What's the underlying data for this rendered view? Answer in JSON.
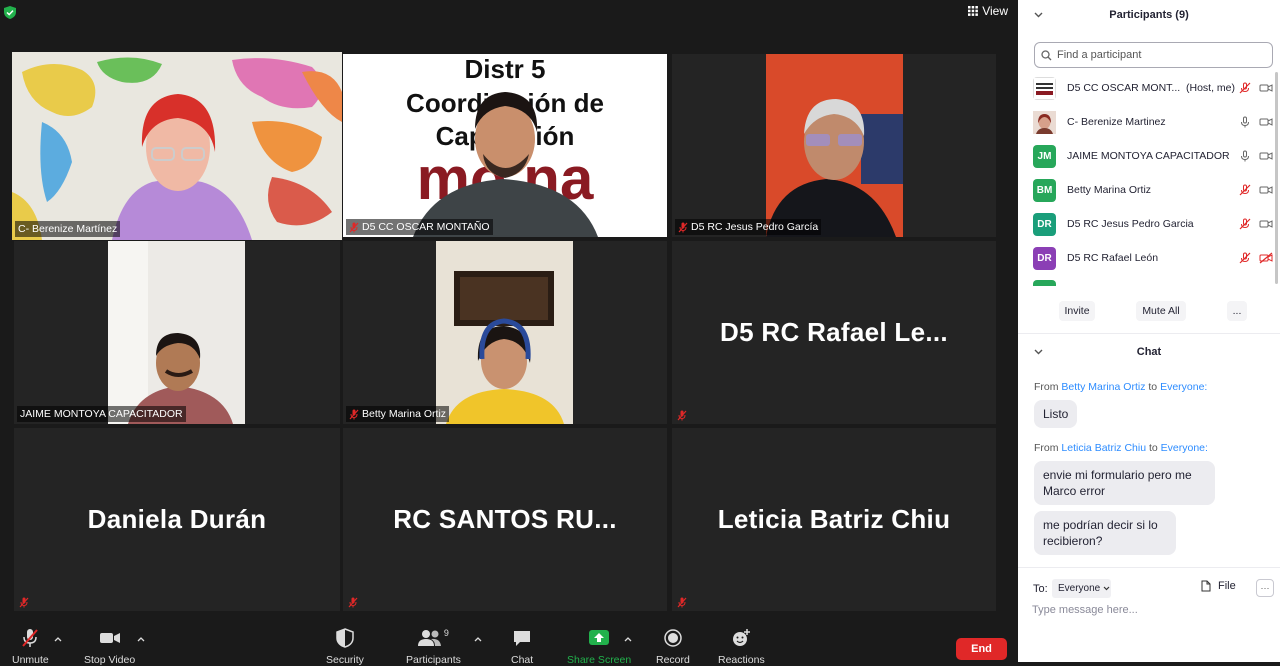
{
  "view_label": "View",
  "tiles": [
    {
      "name": "C- Berenize Martínez",
      "muted": false,
      "active": true
    },
    {
      "name": "D5 CC OSCAR MONTAÑO",
      "muted": true
    },
    {
      "name": "D5 RC Jesus Pedro García",
      "muted": true
    },
    {
      "name": "JAIME MONTOYA CAPACITADOR",
      "muted": false
    },
    {
      "name": "Betty Marina Ortiz",
      "muted": true
    },
    {
      "big": "D5 RC Rafael Le...",
      "muted": true
    },
    {
      "big": "Daniela Durán",
      "muted": true
    },
    {
      "big": "RC SANTOS RU...",
      "muted": true
    },
    {
      "big": "Leticia Batriz Chiu",
      "muted": true
    }
  ],
  "banner_text": {
    "line1": "Distr 5",
    "line2": "Coordin ción de",
    "line3": "Capac ción",
    "brand": "mo na"
  },
  "toolbar": {
    "unmute": "Unmute",
    "stop_video": "Stop Video",
    "security": "Security",
    "participants": "Participants",
    "participants_count": "9",
    "chat": "Chat",
    "share_screen": "Share Screen",
    "record": "Record",
    "reactions": "Reactions",
    "end": "End"
  },
  "panel": {
    "participants_title": "Participants (9)",
    "search_placeholder": "Find a participant",
    "participants": [
      {
        "initials": "",
        "name": "D5 CC OSCAR MONT...",
        "tag": "(Host, me)",
        "color": "#ffffff",
        "mic": "off",
        "cam": "on"
      },
      {
        "initials": "",
        "name": "C- Berenize Martinez",
        "tag": "",
        "color": "#7a3b2e",
        "mic": "on",
        "cam": "on"
      },
      {
        "initials": "JM",
        "name": "JAIME MONTOYA CAPACITADOR",
        "tag": "",
        "color": "#27a75a",
        "mic": "on",
        "cam": "on"
      },
      {
        "initials": "BM",
        "name": "Betty Marina Ortiz",
        "tag": "",
        "color": "#27a75a",
        "mic": "off",
        "cam": "on"
      },
      {
        "initials": "DR",
        "name": "D5 RC Jesus Pedro Garcia",
        "tag": "",
        "color": "#1a9e7a",
        "mic": "off",
        "cam": "on"
      },
      {
        "initials": "DR",
        "name": "D5 RC Rafael León",
        "tag": "",
        "color": "#8b3fb5",
        "mic": "off",
        "cam": "off"
      }
    ],
    "invite": "Invite",
    "mute_all": "Mute All",
    "more": "...",
    "chat_title": "Chat",
    "messages": [
      {
        "from_label": "From",
        "sender": "Betty Marina Ortiz",
        "to_label": "to",
        "recipient": "Everyone:",
        "bubbles": [
          "Listo"
        ]
      },
      {
        "from_label": "From",
        "sender": "Leticia Batriz Chiu",
        "to_label": "to",
        "recipient": "Everyone:",
        "bubbles": [
          "envie mi formulario pero me Marco error",
          "me podrían decir si lo recibieron?"
        ]
      }
    ],
    "to_label": "To:",
    "to_value": "Everyone",
    "file_label": "File",
    "message_placeholder": "Type message here..."
  }
}
